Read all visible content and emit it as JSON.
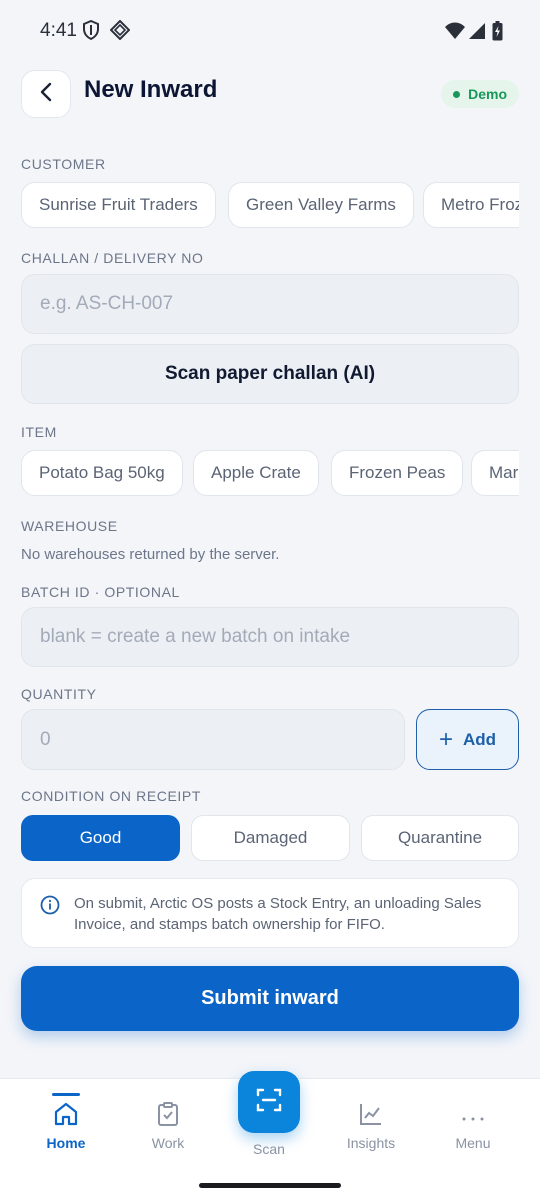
{
  "status_bar": {
    "time": "4:41"
  },
  "header": {
    "title": "New Inward",
    "badge": "Demo"
  },
  "customer": {
    "label": "CUSTOMER",
    "chips": [
      "Sunrise Fruit Traders",
      "Green Valley Farms",
      "Metro Froz"
    ]
  },
  "challan": {
    "label": "CHALLAN / DELIVERY NO",
    "placeholder": "e.g. AS-CH-007",
    "scan_button": "Scan paper challan (AI)"
  },
  "item": {
    "label": "ITEM",
    "chips": [
      "Potato Bag 50kg",
      "Apple Crate",
      "Frozen Peas",
      "Mar"
    ]
  },
  "warehouse": {
    "label": "WAREHOUSE",
    "message": "No warehouses returned by the server."
  },
  "batch": {
    "label": "BATCH ID · OPTIONAL",
    "placeholder": "blank = create a new batch on intake"
  },
  "quantity": {
    "label": "QUANTITY",
    "placeholder": "0",
    "add_button": "Add"
  },
  "condition": {
    "label": "CONDITION ON RECEIPT",
    "options": [
      "Good",
      "Damaged",
      "Quarantine"
    ],
    "selected": "Good"
  },
  "info": {
    "text": "On submit, Arctic OS posts a Stock Entry, an unloading Sales Invoice, and stamps batch ownership for FIFO."
  },
  "submit": {
    "label": "Submit inward"
  },
  "bottom_nav": {
    "items": [
      "Home",
      "Work",
      "Scan",
      "Insights",
      "Menu"
    ],
    "active": "Home"
  },
  "colors": {
    "primary": "#0b65c8",
    "scan_fab": "#0b84dc",
    "demo_green": "#17975a",
    "background": "#f3f5f9"
  }
}
